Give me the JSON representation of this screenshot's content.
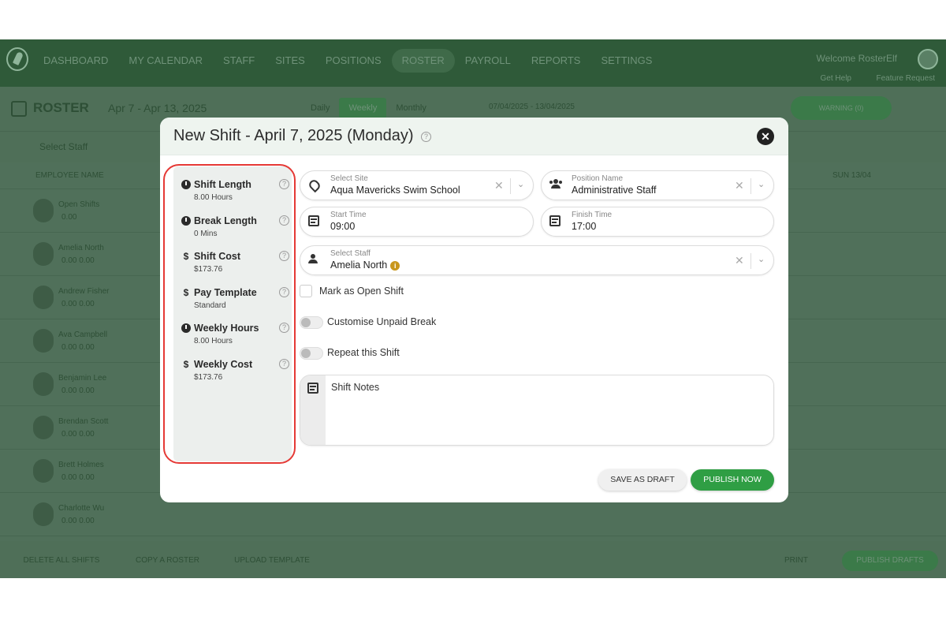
{
  "nav": {
    "items": [
      "DASHBOARD",
      "MY CALENDAR",
      "STAFF",
      "SITES",
      "POSITIONS",
      "ROSTER",
      "PAYROLL",
      "REPORTS",
      "SETTINGS"
    ],
    "active": "ROSTER",
    "welcome": "Welcome RosterElf",
    "get_help": "Get Help",
    "feature_request": "Feature Request"
  },
  "roster": {
    "title": "ROSTER",
    "range": "Apr 7 - Apr 13, 2025",
    "views": [
      "Daily",
      "Weekly",
      "Monthly"
    ],
    "active_view": "Weekly",
    "date_range": "07/04/2025 - 13/04/2025",
    "warning": "WARNING (0)",
    "select_staff": "Select Staff",
    "employee_col": "EMPLOYEE NAME",
    "sun_col": "SUN 13/04"
  },
  "employees": [
    {
      "name": "Open Shifts",
      "vals": "0.00"
    },
    {
      "name": "Amelia North",
      "vals": "0.00   0.00"
    },
    {
      "name": "Andrew Fisher",
      "vals": "0.00   0.00"
    },
    {
      "name": "Ava Campbell",
      "vals": "0.00   0.00"
    },
    {
      "name": "Benjamin Lee",
      "vals": "0.00   0.00"
    },
    {
      "name": "Brendan Scott",
      "vals": "0.00   0.00"
    },
    {
      "name": "Brett Holmes",
      "vals": "0.00   0.00"
    },
    {
      "name": "Charlotte Wu",
      "vals": "0.00   0.00"
    }
  ],
  "footer": {
    "delete": "DELETE ALL SHIFTS",
    "copy": "COPY A ROSTER",
    "upload": "UPLOAD TEMPLATE",
    "print": "PRINT",
    "publish": "PUBLISH DRAFTS"
  },
  "modal": {
    "title": "New Shift - April 7, 2025 (Monday)",
    "summary": [
      {
        "label": "Shift Length",
        "value": "8.00 Hours",
        "icon": "clock-icon"
      },
      {
        "label": "Break Length",
        "value": "0 Mins",
        "icon": "clock-icon"
      },
      {
        "label": "Shift Cost",
        "value": "$173.76",
        "icon": "dollar-icon"
      },
      {
        "label": "Pay Template",
        "value": "Standard",
        "icon": "dollar-icon"
      },
      {
        "label": "Weekly Hours",
        "value": "8.00 Hours",
        "icon": "clock-icon"
      },
      {
        "label": "Weekly Cost",
        "value": "$173.76",
        "icon": "dollar-icon"
      }
    ],
    "site": {
      "label": "Select Site",
      "value": "Aqua Mavericks Swim School"
    },
    "position": {
      "label": "Position Name",
      "value": "Administrative Staff"
    },
    "start": {
      "label": "Start Time",
      "value": "09:00"
    },
    "finish": {
      "label": "Finish Time",
      "value": "17:00"
    },
    "staff": {
      "label": "Select Staff",
      "value": "Amelia North"
    },
    "open_shift": "Mark as Open Shift",
    "unpaid_break": "Customise Unpaid Break",
    "repeat": "Repeat this Shift",
    "notes_label": "Shift Notes",
    "save_draft": "SAVE AS DRAFT",
    "publish_now": "PUBLISH NOW"
  },
  "colors": {
    "accent_green": "#2f9e44",
    "highlight_red": "#e53935"
  }
}
